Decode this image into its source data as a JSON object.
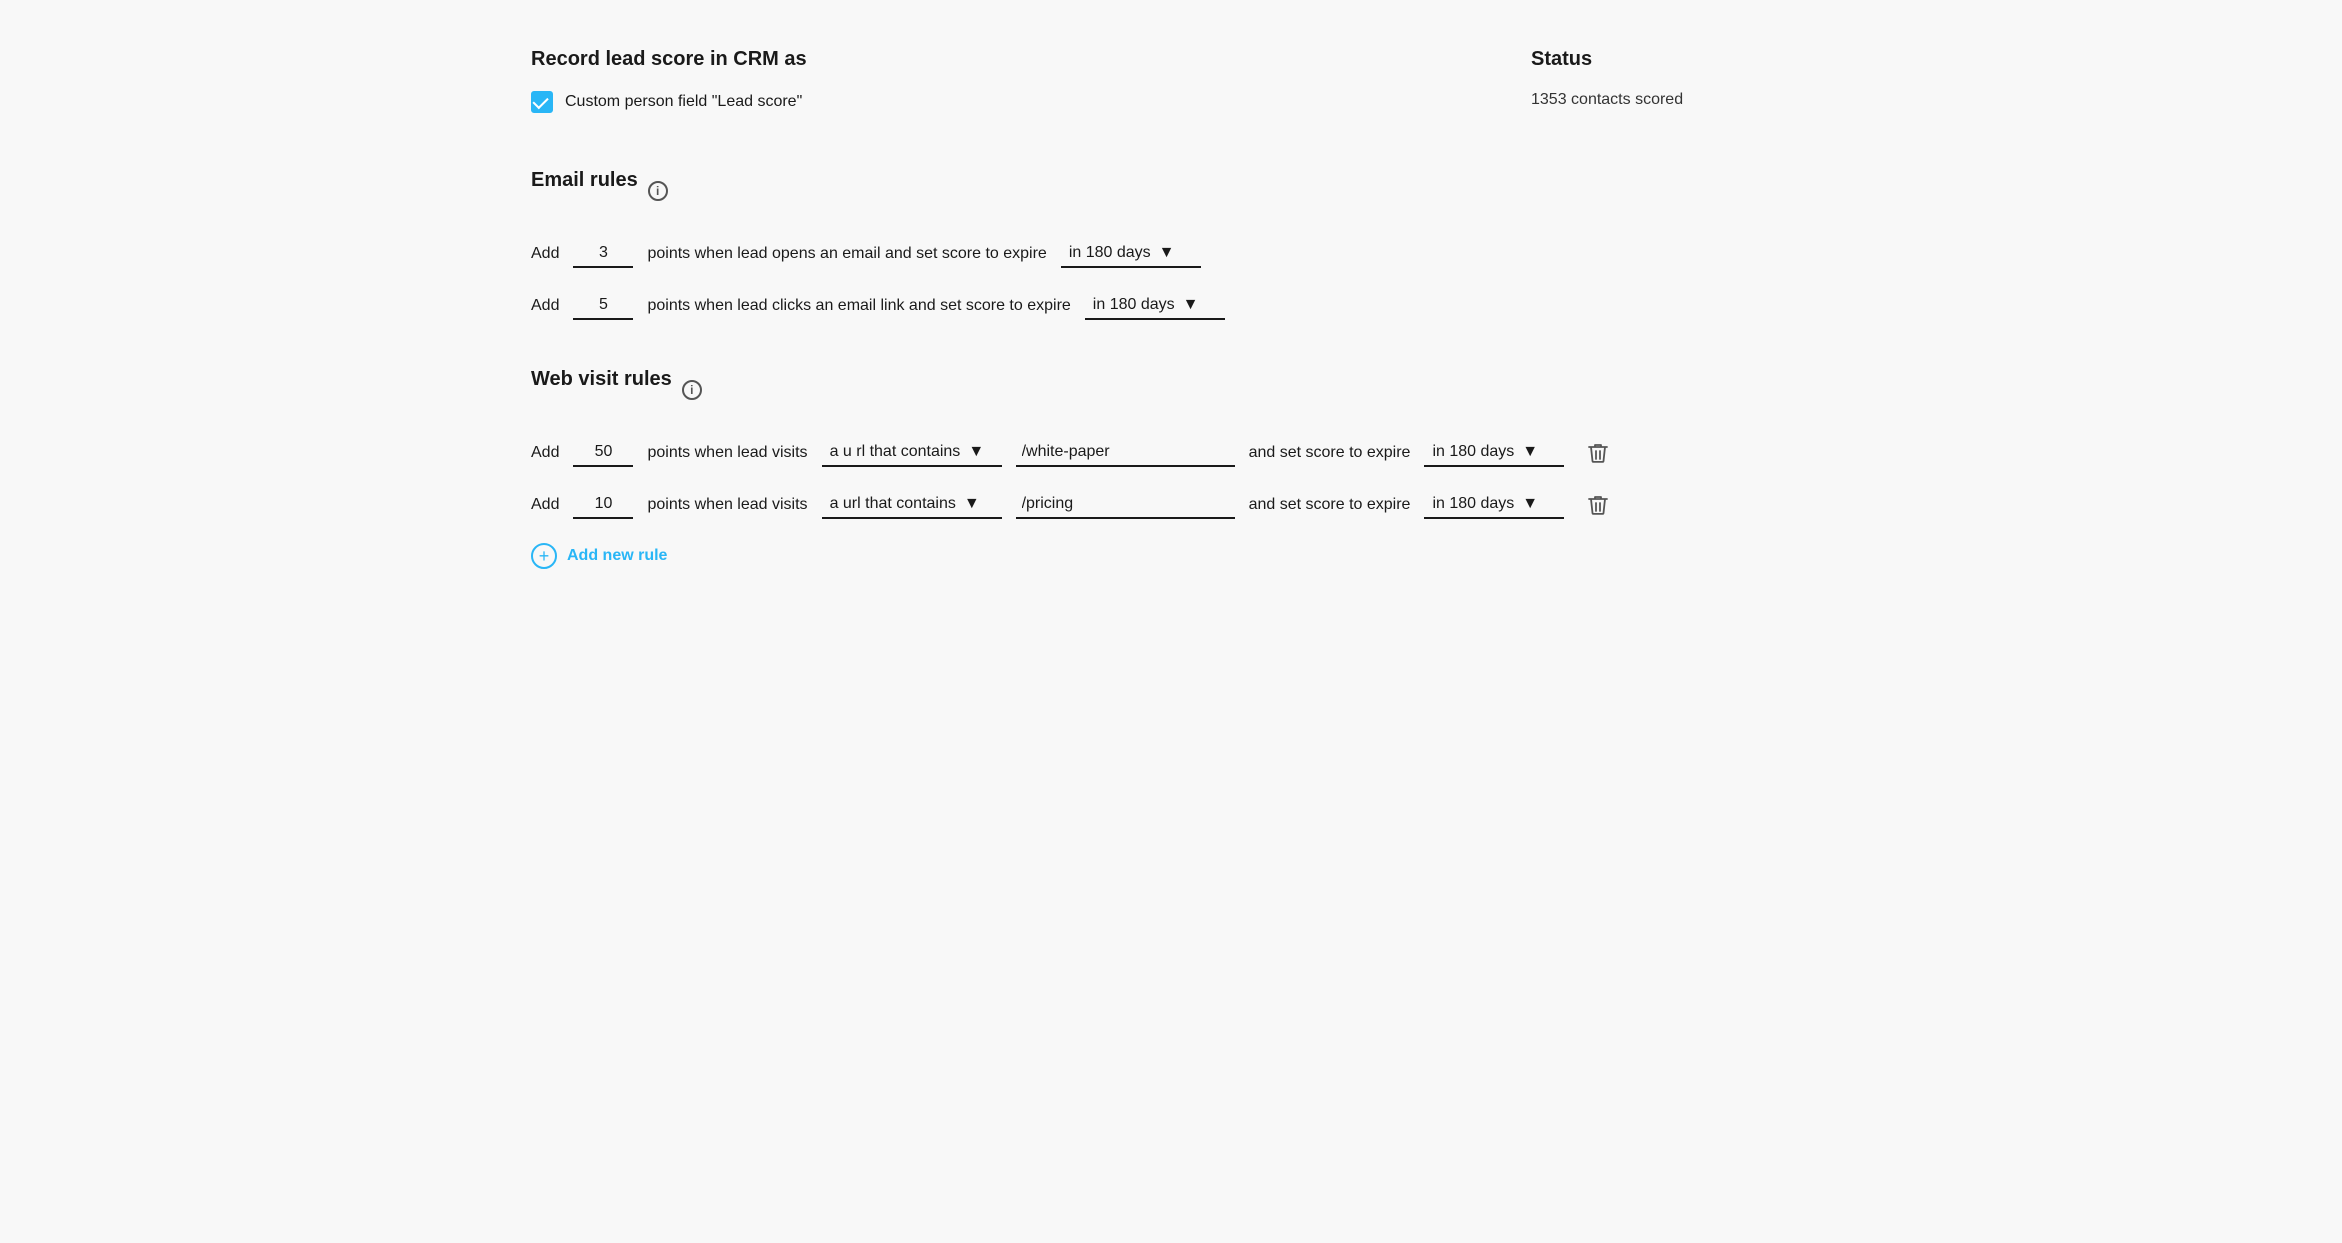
{
  "crm": {
    "title": "Record lead score in CRM as",
    "checkbox_checked": true,
    "checkbox_label": "Custom person field \"Lead score\""
  },
  "status": {
    "title": "Status",
    "count_text": "1353 contacts scored"
  },
  "email_rules": {
    "title": "Email rules",
    "info_icon": "info-icon",
    "rows": [
      {
        "add_label": "Add",
        "points_value": "3",
        "rule_text": "points when lead opens an email and set score to expire",
        "expire_label": "in 180 days"
      },
      {
        "add_label": "Add",
        "points_value": "5",
        "rule_text": "points when lead clicks an email link and set score to expire",
        "expire_label": "in 180 days"
      }
    ]
  },
  "web_visit_rules": {
    "title": "Web visit rules",
    "info_icon": "info-icon",
    "rows": [
      {
        "add_label": "Add",
        "points_value": "50",
        "rule_text": "points when lead visits",
        "url_condition": "a u rl that contains",
        "url_value": "/white-paper",
        "expire_text": "and set score to expire",
        "expire_label": "in 180 days"
      },
      {
        "add_label": "Add",
        "points_value": "10",
        "rule_text": "points when lead visits",
        "url_condition": "a url that contains",
        "url_value": "/pricing",
        "expire_text": "and set score to expire",
        "expire_label": "in 180 days"
      }
    ],
    "add_rule_label": "Add new rule"
  }
}
